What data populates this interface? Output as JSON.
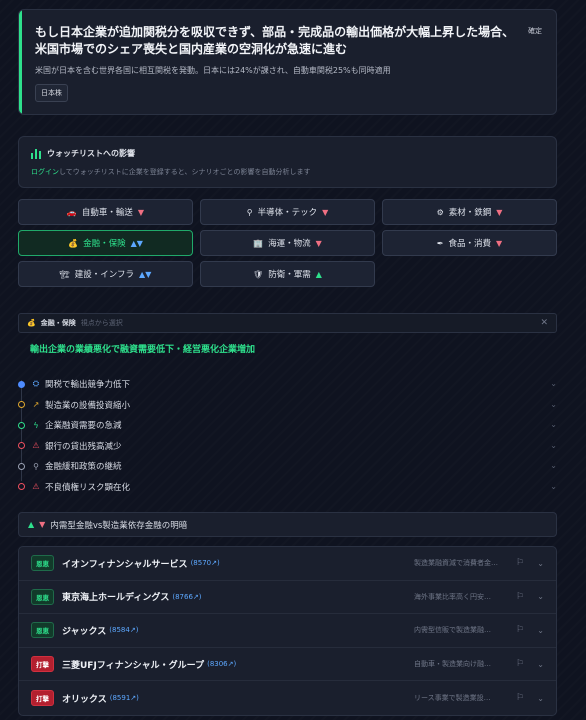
{
  "scenario": {
    "title": "もし日本企業が追加関税分を吸収できず、部品・完成品の輸出価格が大幅上昇した場合、米国市場でのシェア喪失と国内産業の空洞化が急速に進む",
    "confirm_label": "確定",
    "description": "米国が日本を含む世界各国に相互関税を発動。日本には24%が課され、自動車関税25%も同時適用",
    "tag": "日本株"
  },
  "watchlist": {
    "title": "ウォッチリストへの影響",
    "login_link": "ログイン",
    "description_rest": "してウォッチリストに企業を登録すると、シナリオごとの影響を自動分析します"
  },
  "sectors": [
    {
      "label": "自動車・輸送",
      "icon": "🚗",
      "trend": "▼",
      "trend_type": "down",
      "active": false
    },
    {
      "label": "半導体・テック",
      "icon": "⚲",
      "trend": "▼",
      "trend_type": "down",
      "active": false
    },
    {
      "label": "素材・鉄鋼",
      "icon": "⚙",
      "trend": "▼",
      "trend_type": "down",
      "active": false
    },
    {
      "label": "金融・保険",
      "icon": "💰",
      "trend": "▲▼",
      "trend_type": "mixed",
      "active": true
    },
    {
      "label": "海運・物流",
      "icon": "🏢",
      "trend": "▼",
      "trend_type": "down",
      "active": false
    },
    {
      "label": "食品・消費",
      "icon": "✒",
      "trend": "▼",
      "trend_type": "down",
      "active": false
    },
    {
      "label": "建設・インフラ",
      "icon": "🏗",
      "trend": "▲▼",
      "trend_type": "mixed",
      "active": false
    },
    {
      "label": "防衛・軍需",
      "icon": "🛡",
      "trend": "▲",
      "trend_type": "up",
      "active": false
    }
  ],
  "selected_sector": {
    "name": "金融・保険",
    "hint": "視点から選択",
    "headline": "輸出企業の業績悪化で融資需要低下・経営悪化企業増加"
  },
  "chain": [
    {
      "label": "関税で輸出競争力低下",
      "icon": "⛭",
      "dot_color": "#4e8cff",
      "icon_color": "#5da8ff",
      "filled": true
    },
    {
      "label": "製造業の設備投資縮小",
      "icon": "↗",
      "dot_color": "#e0a82e",
      "icon_color": "#e0a82e",
      "filled": false
    },
    {
      "label": "企業融資需要の急減",
      "icon": "ϟ",
      "dot_color": "#2ee08c",
      "icon_color": "#2ee08c",
      "filled": false
    },
    {
      "label": "銀行の貸出残高減少",
      "icon": "⚠",
      "dot_color": "#ef4f5f",
      "icon_color": "#ef4f5f",
      "filled": false
    },
    {
      "label": "金融緩和政策の継続",
      "icon": "⚲",
      "dot_color": "#9aa1b2",
      "icon_color": "#9aa1b2",
      "filled": false
    },
    {
      "label": "不良債権リスク顕在化",
      "icon": "⚠",
      "dot_color": "#ef4f5f",
      "icon_color": "#ef4f5f",
      "filled": false
    }
  ],
  "contrast": {
    "up": "▲",
    "down": "▼",
    "label": "内需型金融vs製造業依存金融の明暗"
  },
  "companies": [
    {
      "badge": "恩恵",
      "badge_type": "good",
      "name": "イオンフィナンシャルサービス",
      "code": "(8570↗)",
      "reason": "製造業融資減で消費者金融…"
    },
    {
      "badge": "恩恵",
      "badge_type": "good",
      "name": "東京海上ホールディングス",
      "code": "(8766↗)",
      "reason": "海外事業比率高く円安…"
    },
    {
      "badge": "恩恵",
      "badge_type": "good",
      "name": "ジャックス",
      "code": "(8584↗)",
      "reason": "内需型信販で製造業融…"
    },
    {
      "badge": "打撃",
      "badge_type": "bad",
      "name": "三菱UFJフィナンシャル・グループ",
      "code": "(8306↗)",
      "reason": "自動車・製造業向け融…"
    },
    {
      "badge": "打撃",
      "badge_type": "bad",
      "name": "オリックス",
      "code": "(8591↗)",
      "reason": "リース事業で製造業設…"
    }
  ],
  "icons": {
    "close": "✕",
    "bookmark": "⚐",
    "chevron": "⌄"
  },
  "colors": {
    "accent": "#2ee08c",
    "danger": "#ef6f82",
    "link": "#5da8ff",
    "background": "#0f1320",
    "card": "#1a1f2d"
  }
}
